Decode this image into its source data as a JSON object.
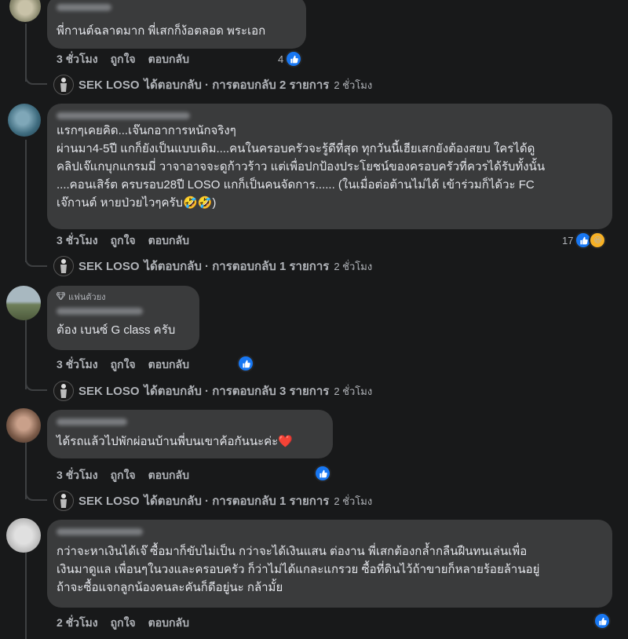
{
  "comments": [
    {
      "text": "พี่กานต์ฉลาดมาก พี่เสกก็ง้อตลอด พระเอก",
      "time": "3 ชั่วโมง",
      "like": "ถูกใจ",
      "reply": "ตอบกลับ",
      "reactions_count": "4",
      "reply_summary": {
        "author": "SEK LOSO",
        "label": "ได้ตอบกลับ · การตอบกลับ 2 รายการ",
        "time": "2 ชั่วโมง"
      }
    },
    {
      "text": "แรกๆเคยคิด...เจ๊นกอาการหนักจริงๆ\nผ่านมา4-5ปี แกก็ยังเป็นแบบเดิม....คนในครอบครัวจะรู้ดีที่สุด ทุกวันนี้เฮียเสกยังต้องสยบ ใครได้ดู\nคลิปเจ๊แกบุกแกรมมี่ วาจาอาจจะดูก้าวร้าว แต่เพื่อปกป้องประโยชน์ของครอบครัวที่ควรได้รับทั้งนั้น\n....คอนเสิร์ต ครบรอบ28ปี LOSO แกก็เป็นคนจัดการ...... (ในเมื่อต่อต้านไม่ได้ เข้าร่วมก็ได้วะ FC\nเจ๊กานต์ หายป่วยไวๆครับ🤣🤣)",
      "time": "3 ชั่วโมง",
      "like": "ถูกใจ",
      "reply": "ตอบกลับ",
      "reactions_count": "17",
      "reply_summary": {
        "author": "SEK LOSO",
        "label": "ได้ตอบกลับ · การตอบกลับ 1 รายการ",
        "time": "2 ชั่วโมง"
      }
    },
    {
      "badge": "แฟนตัวยง",
      "text": "ต้อง เบนซ์ G class ครับ",
      "time": "3 ชั่วโมง",
      "like": "ถูกใจ",
      "reply": "ตอบกลับ",
      "reply_summary": {
        "author": "SEK LOSO",
        "label": "ได้ตอบกลับ · การตอบกลับ 3 รายการ",
        "time": "2 ชั่วโมง"
      }
    },
    {
      "text": "ได้รถแล้วไปพักผ่อนบ้านพี่บนเขาค้อกันนะค่ะ❤️",
      "time": "3 ชั่วโมง",
      "like": "ถูกใจ",
      "reply": "ตอบกลับ",
      "reply_summary": {
        "author": "SEK LOSO",
        "label": "ได้ตอบกลับ · การตอบกลับ 1 รายการ",
        "time": "2 ชั่วโมง"
      }
    },
    {
      "text": "กว่าจะหาเงินได้เจ๊ ซื้อมาก็ขับไม่เป็น กว่าจะได้เงินแสน ต่องาน พี่เสกต้องกล้ำกลืนฝืนทนเล่นเพื่อ\nเงินมาดูแล เพื่อนๆในวงและครอบครัว ก็ว่าไม่ได้แกละแกรวย ซื้อที่ดินไว้ถ้าขายก็หลายร้อยล้านอยู่\nถ้าจะซื้อแจกลูกน้องคนละคันก็ดีอยู่นะ กล้ามั้ย",
      "time": "2 ชั่วโมง",
      "like": "ถูกใจ",
      "reply": "ตอบกลับ"
    }
  ],
  "colors": {
    "background": "#18191a",
    "bubble": "#3a3b3c",
    "text": "#e4e6eb",
    "secondary_text": "#b0b3b8",
    "like_blue": "#1877f2",
    "thread_line": "#3e4042"
  },
  "icons": [
    "like-reaction-icon",
    "haha-reaction-icon",
    "diamond-badge-icon",
    "sek-loso-avatar"
  ]
}
